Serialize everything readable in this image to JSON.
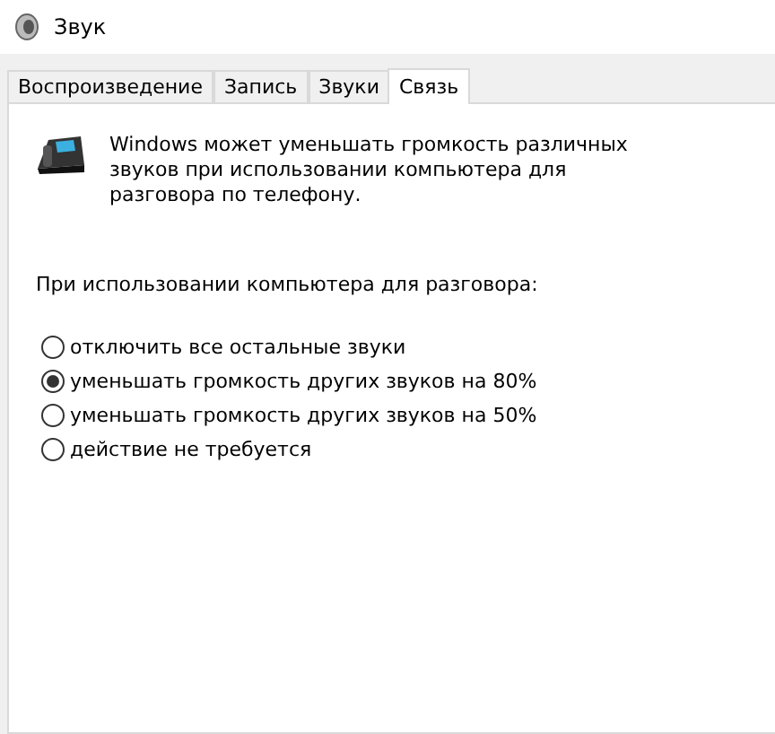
{
  "window": {
    "title": "Звук"
  },
  "tabs": [
    {
      "label": "Воспроизведение",
      "selected": false
    },
    {
      "label": "Запись",
      "selected": false
    },
    {
      "label": "Звуки",
      "selected": false
    },
    {
      "label": "Связь",
      "selected": true
    }
  ],
  "description": "Windows может уменьшать громкость различных звуков при использовании компьютера для разговора по телефону.",
  "prompt": "При использовании компьютера для разговора:",
  "options": [
    {
      "label": "отключить все остальные звуки",
      "selected": false
    },
    {
      "label": "уменьшать громкость других звуков на 80%",
      "selected": true
    },
    {
      "label": "уменьшать громкость других звуков на 50%",
      "selected": false
    },
    {
      "label": "действие не требуется",
      "selected": false
    }
  ]
}
